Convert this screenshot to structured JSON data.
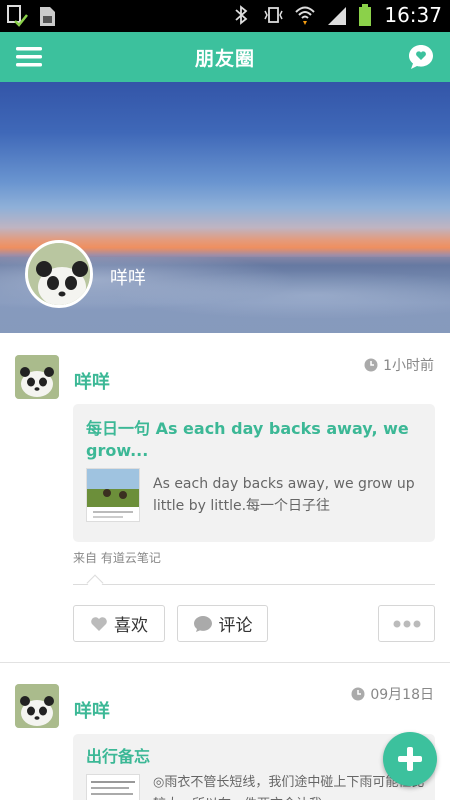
{
  "status_bar": {
    "time": "16:37",
    "icons": [
      "document-check-icon",
      "sd-card-icon",
      "bluetooth-icon",
      "vibrate-icon",
      "wifi-icon",
      "signal-icon",
      "battery-icon"
    ]
  },
  "header": {
    "title": "朋友圈",
    "menu_icon": "menu-icon",
    "chat_icon": "chat-bubble-icon",
    "accent_color": "#3cc19d"
  },
  "cover": {
    "user_name": "咩咩"
  },
  "posts": [
    {
      "author": "咩咩",
      "time": "1小时前",
      "card_title": "每日一句 As each day backs away, we grow...",
      "card_text": "As each day backs away, we grow up little by little.每一个日子往",
      "source": "来自  有道云笔记",
      "actions": {
        "like": "喜欢",
        "comment": "评论"
      }
    },
    {
      "author": "咩咩",
      "time": "09月18日",
      "card_title": "出行备忘",
      "card_text": "◎雨衣不管长短线，我们途中碰上下雨可能性比较大，所以在一件两衣会让我"
    }
  ],
  "fab": {
    "icon": "plus-icon"
  }
}
